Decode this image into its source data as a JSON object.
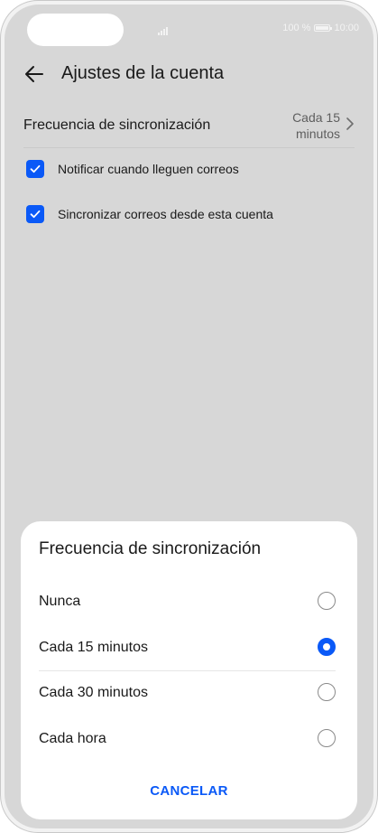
{
  "status_bar": {
    "battery_text": "100 %",
    "time": "10:00"
  },
  "header": {
    "title": "Ajustes de la cuenta"
  },
  "settings": {
    "sync_frequency": {
      "label": "Frecuencia de sincronización",
      "value": "Cada 15 minutos"
    },
    "checkboxes": [
      {
        "label": "Notificar cuando lleguen correos",
        "checked": true
      },
      {
        "label": "Sincronizar correos desde esta cuenta",
        "checked": true
      }
    ]
  },
  "dialog": {
    "title": "Frecuencia de sincronización",
    "options": [
      {
        "label": "Nunca",
        "selected": false
      },
      {
        "label": "Cada 15 minutos",
        "selected": true
      },
      {
        "label": "Cada 30 minutos",
        "selected": false
      },
      {
        "label": "Cada hora",
        "selected": false
      }
    ],
    "cancel_label": "CANCELAR"
  },
  "colors": {
    "accent": "#0a59f7",
    "scrim": "#d7d7d7",
    "sheet": "#ffffff"
  },
  "icons": [
    "signal-icon",
    "battery-icon",
    "back-arrow-icon",
    "chevron-right-icon",
    "check-icon"
  ]
}
